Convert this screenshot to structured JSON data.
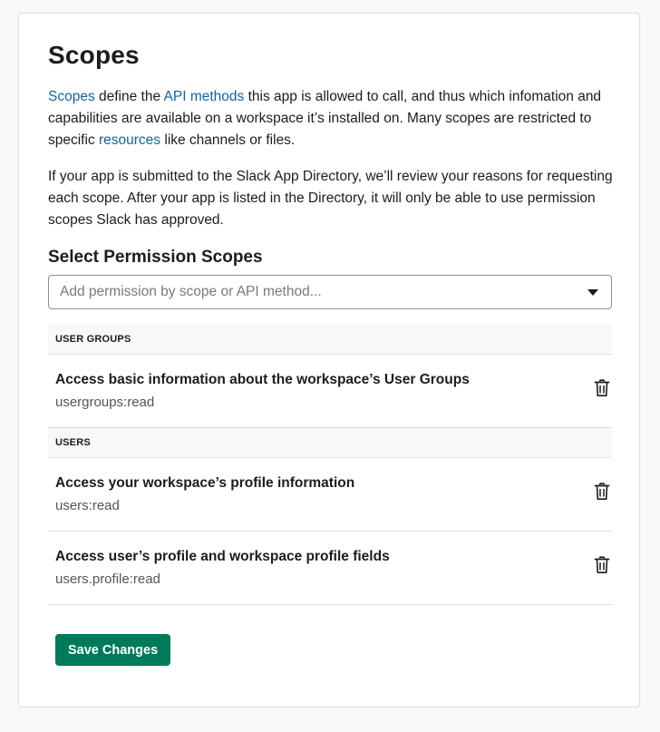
{
  "page": {
    "title": "Scopes",
    "intro": {
      "link1": "Scopes",
      "text1": " define the ",
      "link2": "API methods",
      "text2": " this app is allowed to call, and thus which infomation and capabilities are available on a workspace it’s installed on. Many scopes are restricted to specific ",
      "link3": "resources",
      "text3": " like channels or files."
    },
    "review_text": "If your app is submitted to the Slack App Directory, we’ll review your reasons for requesting each scope. After your app is listed in the Directory, it will only be able to use permission scopes Slack has approved."
  },
  "permissions": {
    "heading": "Select Permission Scopes",
    "select_placeholder": "Add permission by scope or API method...",
    "groups": [
      {
        "label": "USER GROUPS",
        "scopes": [
          {
            "title": "Access basic information about the workspace’s User Groups",
            "code": "usergroups:read"
          }
        ]
      },
      {
        "label": "USERS",
        "scopes": [
          {
            "title": "Access your workspace’s profile information",
            "code": "users:read"
          },
          {
            "title": "Access user’s profile and workspace profile fields",
            "code": "users.profile:read"
          }
        ]
      }
    ]
  },
  "actions": {
    "save_label": "Save Changes"
  },
  "icons": {
    "delete": "trash-icon",
    "dropdown": "caret-down-icon"
  },
  "colors": {
    "link": "#1264a3",
    "primary_button": "#007a5a"
  }
}
